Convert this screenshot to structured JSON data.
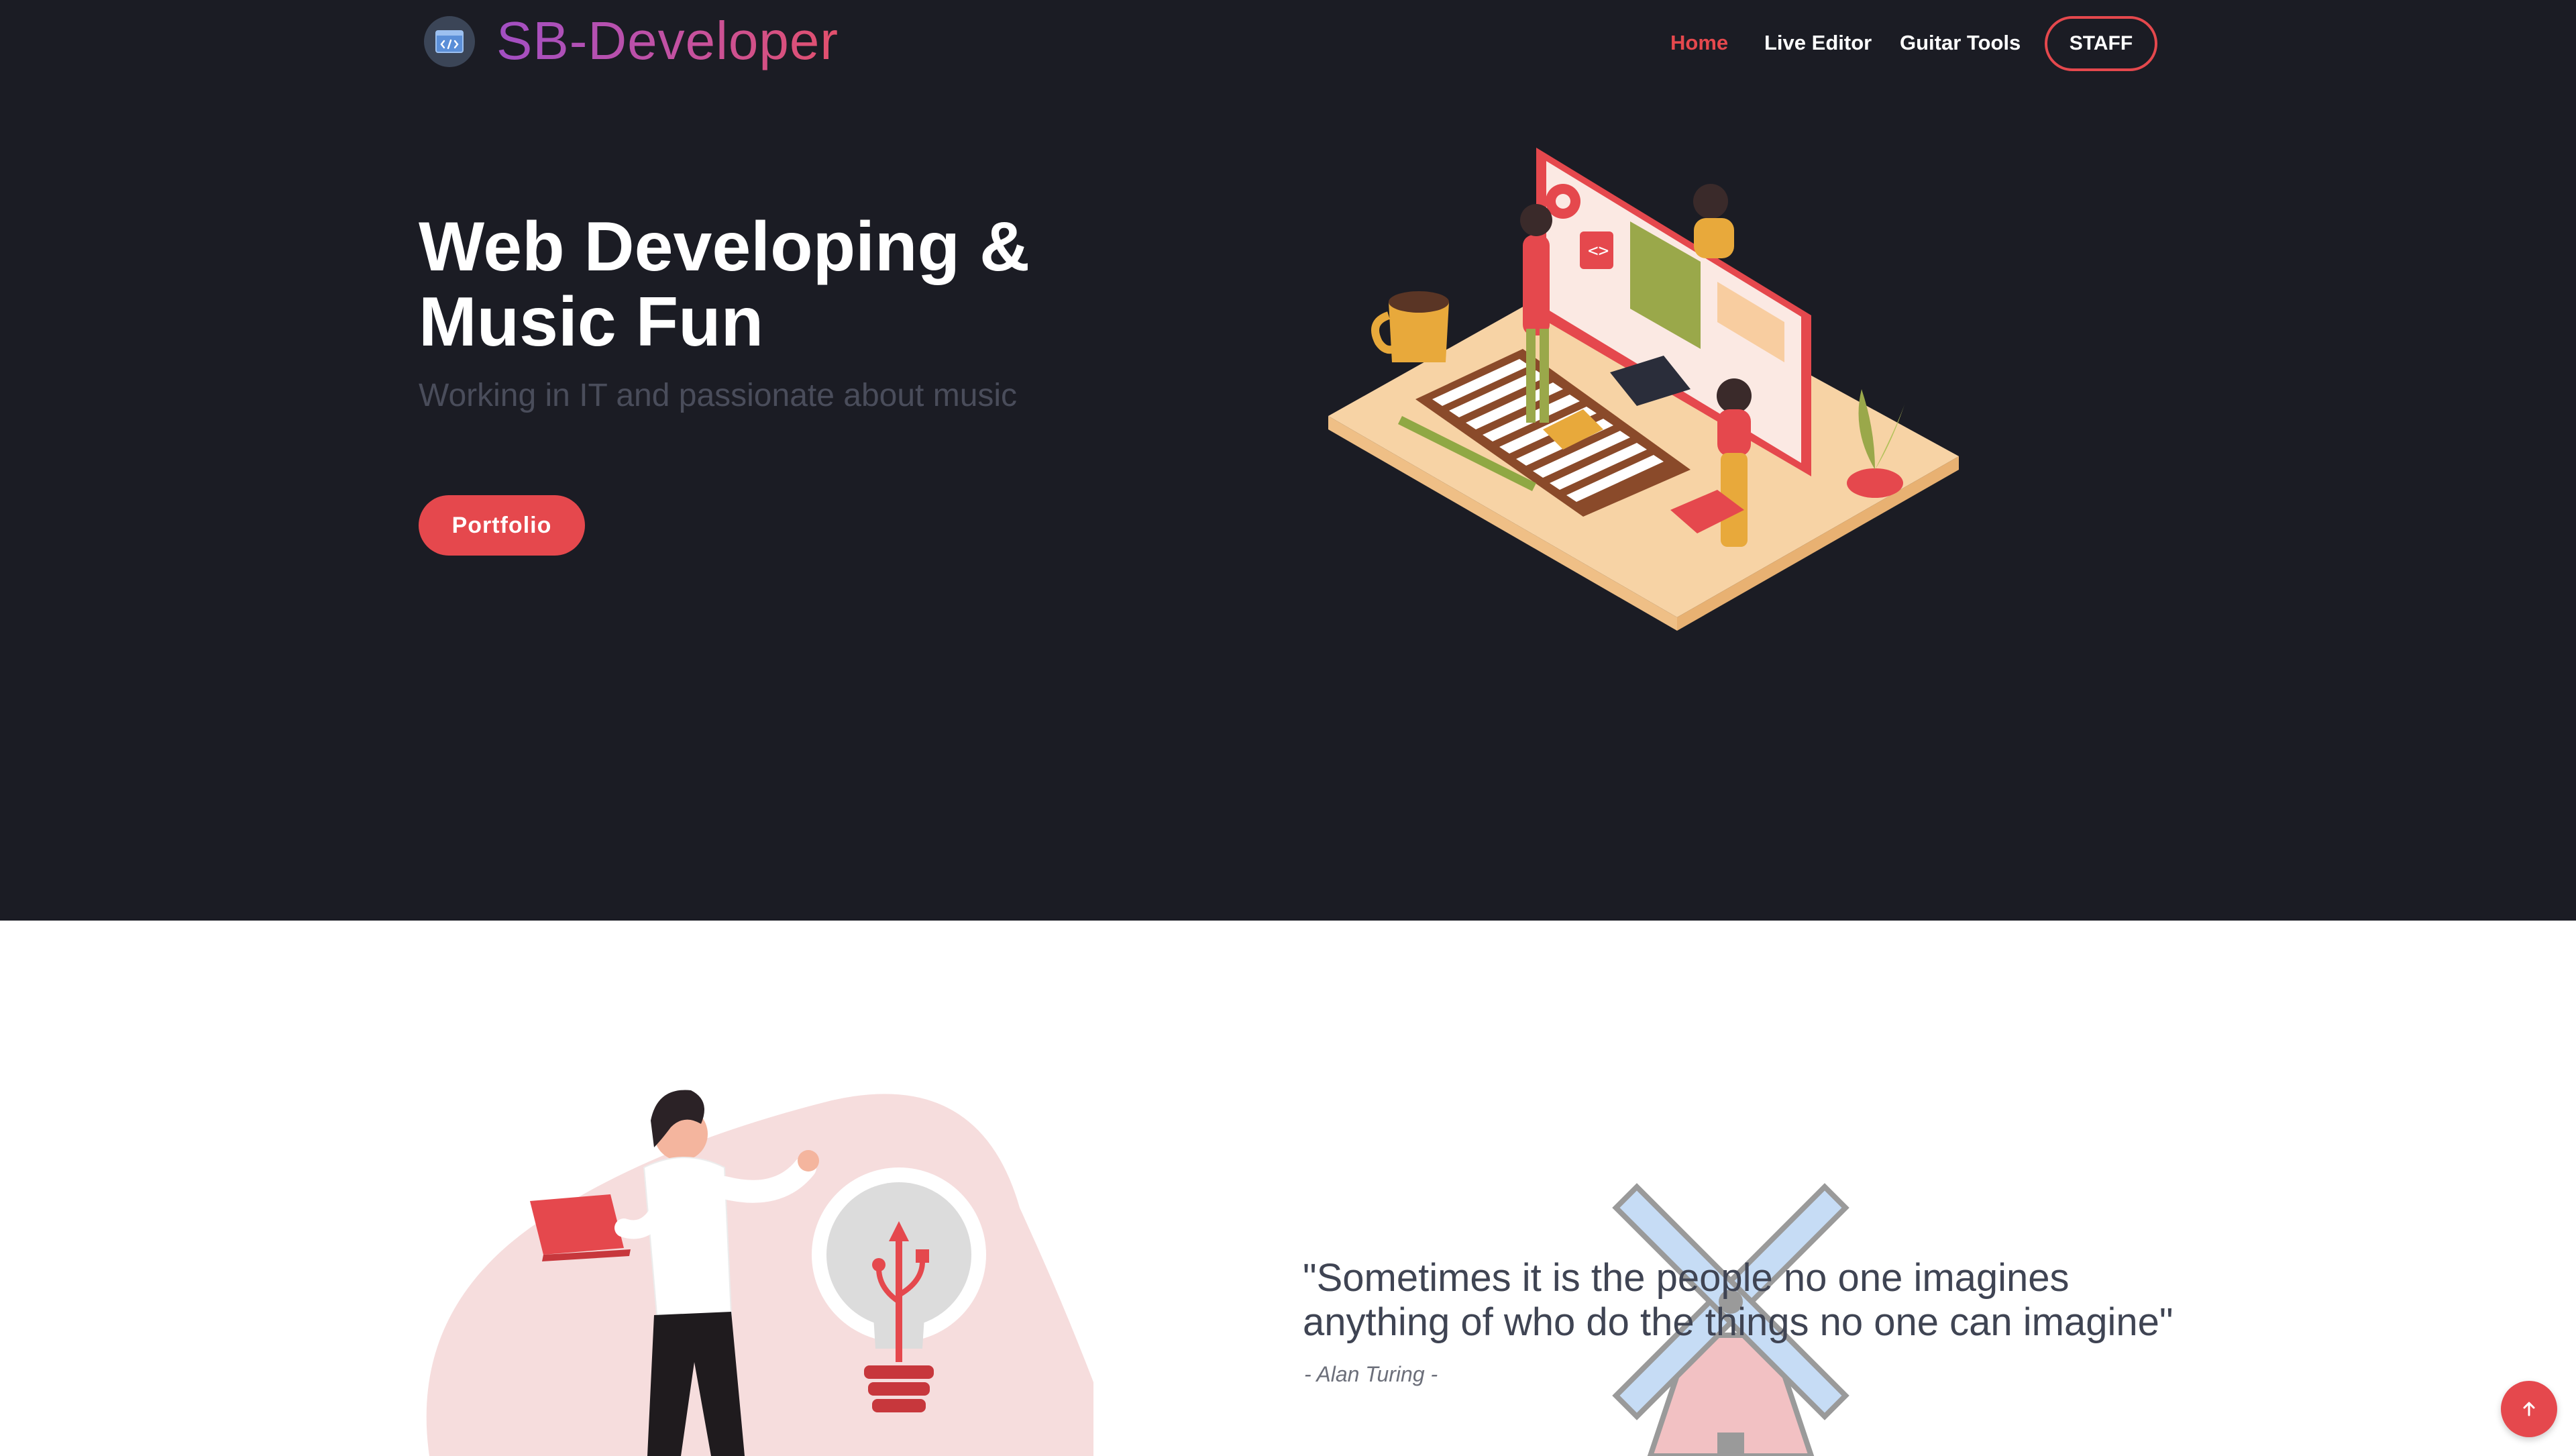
{
  "header": {
    "brand": "SB-Developer",
    "logo_icon": "code-window-icon",
    "nav": {
      "home": "Home",
      "live_editor": "Live Editor",
      "guitar_tools": "Guitar Tools"
    },
    "staff_label": "STAFF"
  },
  "hero": {
    "title": "Web Developing & Music Fun",
    "subtitle": "Working in IT and passionate about music",
    "portfolio_label": "Portfolio",
    "illustration": "desk-computer-illustration"
  },
  "section": {
    "quote": "\"Sometimes it is the people no one imagines anything of who do the things no one can imagine\"",
    "author": "- Alan Turing -",
    "illustration": "person-laptop-lightbulb-illustration",
    "background_icon": "windmill-icon"
  },
  "back_to_top_icon": "arrow-up-icon",
  "colors": {
    "accent": "#e5484d",
    "hero_bg": "#1b1c24",
    "brand_gradient_start": "#a24fc4",
    "brand_gradient_end": "#e3506c",
    "subtitle": "#4a4d5b"
  }
}
